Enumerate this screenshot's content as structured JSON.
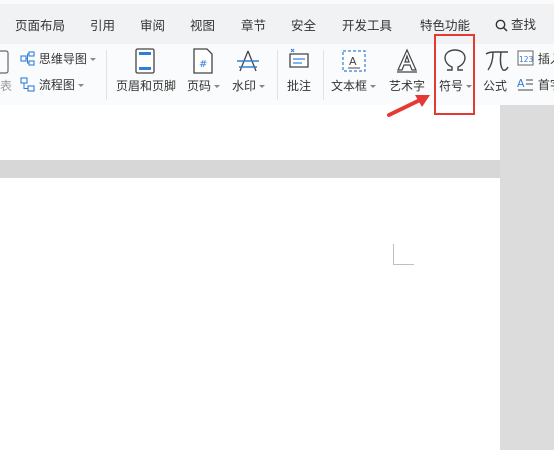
{
  "tabs": [
    "页面布局",
    "引用",
    "审阅",
    "视图",
    "章节",
    "安全",
    "开发工具",
    "特色功能"
  ],
  "search_label": "查找",
  "ribbon": {
    "left_partial_label": "表",
    "mindmap_label": "思维导图",
    "flowchart_label": "流程图",
    "header_footer_label": "页眉和页脚",
    "page_number_label": "页码",
    "watermark_label": "水印",
    "comment_label": "批注",
    "textbox_label": "文本框",
    "wordart_label": "艺术字",
    "symbol_label": "符号",
    "formula_label": "公式",
    "insert_number_label": "插入",
    "first_letter_label": "首字"
  },
  "colors": {
    "highlight": "#e53935",
    "arrow": "#e53935",
    "accent_blue": "#2f7fd8"
  }
}
